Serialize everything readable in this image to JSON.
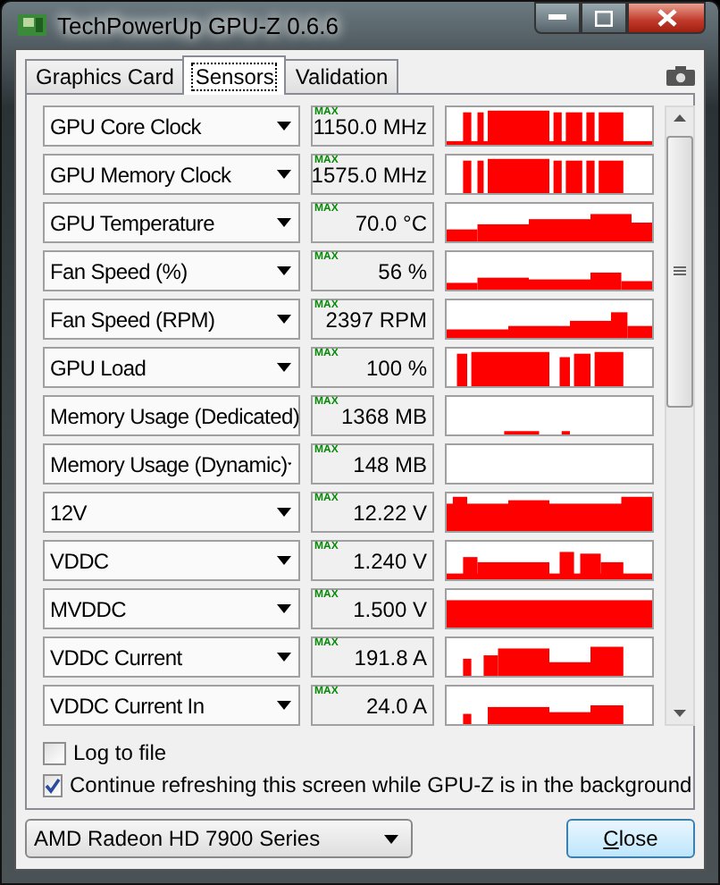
{
  "window": {
    "title": "TechPowerUp GPU-Z 0.6.6"
  },
  "tabs": [
    {
      "label": "Graphics Card",
      "selected": false
    },
    {
      "label": "Sensors",
      "selected": true
    },
    {
      "label": "Validation",
      "selected": false
    }
  ],
  "sensors": [
    {
      "name": "GPU Core Clock",
      "max_label": "MAX",
      "value": "1150.0 MHz"
    },
    {
      "name": "GPU Memory Clock",
      "max_label": "MAX",
      "value": "1575.0 MHz"
    },
    {
      "name": "GPU Temperature",
      "max_label": "MAX",
      "value": "70.0 °C"
    },
    {
      "name": "Fan Speed (%)",
      "max_label": "MAX",
      "value": "56 %"
    },
    {
      "name": "Fan Speed (RPM)",
      "max_label": "MAX",
      "value": "2397 RPM"
    },
    {
      "name": "GPU Load",
      "max_label": "MAX",
      "value": "100 %"
    },
    {
      "name": "Memory Usage (Dedicated)",
      "max_label": "MAX",
      "value": "1368 MB"
    },
    {
      "name": "Memory Usage (Dynamic)",
      "max_label": "MAX",
      "value": "148 MB"
    },
    {
      "name": "12V",
      "max_label": "MAX",
      "value": "12.22 V"
    },
    {
      "name": "VDDC",
      "max_label": "MAX",
      "value": "1.240 V"
    },
    {
      "name": "MVDDC",
      "max_label": "MAX",
      "value": "1.500 V"
    },
    {
      "name": "VDDC Current",
      "max_label": "MAX",
      "value": "191.8 A"
    },
    {
      "name": "VDDC Current In",
      "max_label": "MAX",
      "value": "24.0 A"
    }
  ],
  "options": [
    {
      "label": "Log to file",
      "checked": false
    },
    {
      "label": "Continue refreshing this screen while GPU-Z is in the background",
      "checked": true
    }
  ],
  "gpu_select": {
    "value": "AMD Radeon HD 7900 Series"
  },
  "close_button": {
    "label": "Close"
  }
}
